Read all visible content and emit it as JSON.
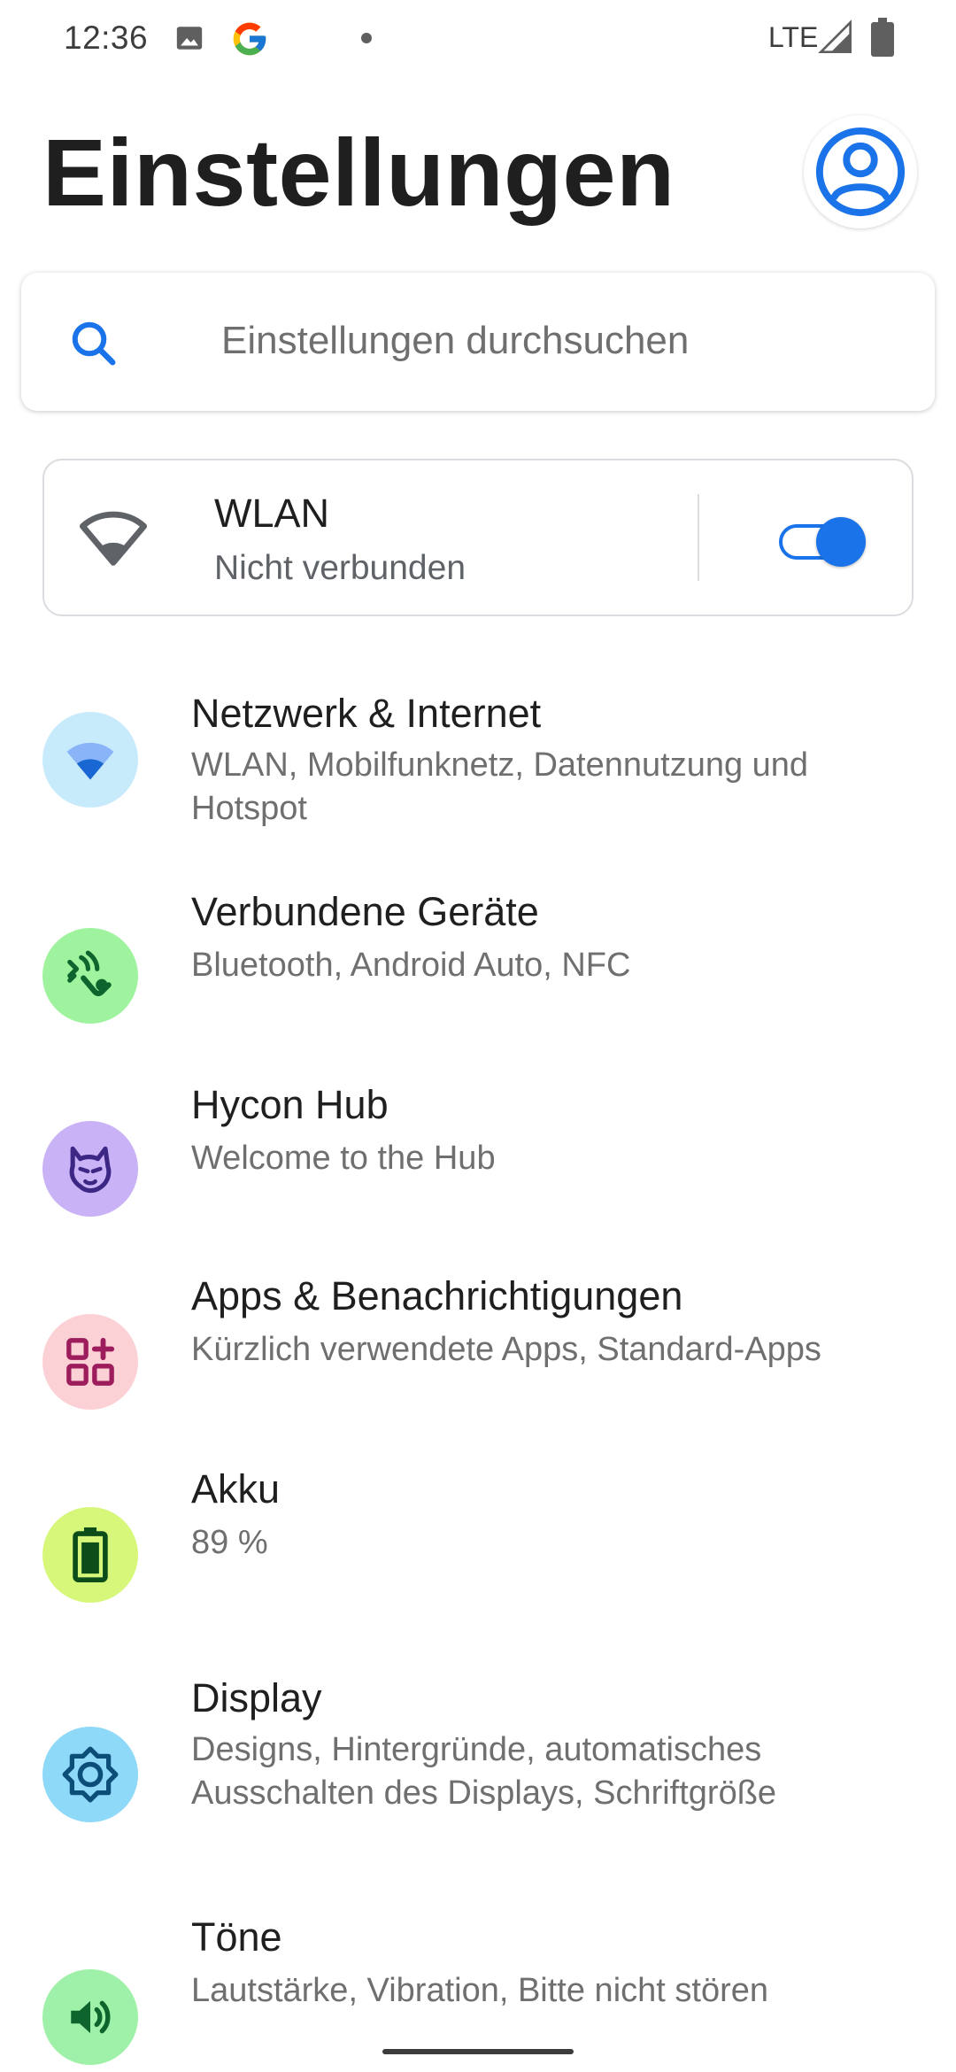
{
  "status_bar": {
    "time": "12:36",
    "network": "LTE",
    "icons": [
      "image-icon",
      "google-icon",
      "notification-dot",
      "signal-icon",
      "battery-icon"
    ]
  },
  "header": {
    "title": "Einstellungen",
    "account_icon": "account-circle-icon"
  },
  "search": {
    "placeholder": "Einstellungen durchsuchen",
    "icon": "search-icon"
  },
  "wlan_card": {
    "title": "WLAN",
    "subtitle": "Nicht verbunden",
    "toggle_on": true,
    "icon": "wifi-icon"
  },
  "settings_items": [
    {
      "title": "Netzwerk & Internet",
      "subtitle": "WLAN, Mobilfunknetz, Datennutzung und Hotspot",
      "icon": "wifi-icon",
      "icon_bg": "#c8ebfc",
      "icon_color": "#1967d2"
    },
    {
      "title": "Verbundene Geräte",
      "subtitle": "Bluetooth, Android Auto, NFC",
      "icon": "connected-devices-icon",
      "icon_bg": "#9ff39e",
      "icon_color": "#0d652d"
    },
    {
      "title": "Hycon Hub",
      "subtitle": "Welcome to the Hub",
      "icon": "wolf-icon",
      "icon_bg": "#c9b2f5",
      "icon_color": "#3d2785"
    },
    {
      "title": "Apps & Benachrichtigungen",
      "subtitle": "Kürzlich verwendete Apps, Standard-Apps",
      "icon": "apps-icon",
      "icon_bg": "#fbd1d6",
      "icon_color": "#9c1c5c"
    },
    {
      "title": "Akku",
      "subtitle": "89 %",
      "icon": "battery-icon",
      "icon_bg": "#d6f77a",
      "icon_color": "#0d4d1a"
    },
    {
      "title": "Display",
      "subtitle": "Designs, Hintergründe, automatisches Ausschalten des Displays, Schriftgröße",
      "icon": "brightness-icon",
      "icon_bg": "#8ed8f8",
      "icon_color": "#0b4e78"
    },
    {
      "title": "Töne",
      "subtitle": "Lautstärke, Vibration, Bitte nicht stören",
      "icon": "volume-icon",
      "icon_bg": "#9ff0a8",
      "icon_color": "#0d652d"
    }
  ]
}
